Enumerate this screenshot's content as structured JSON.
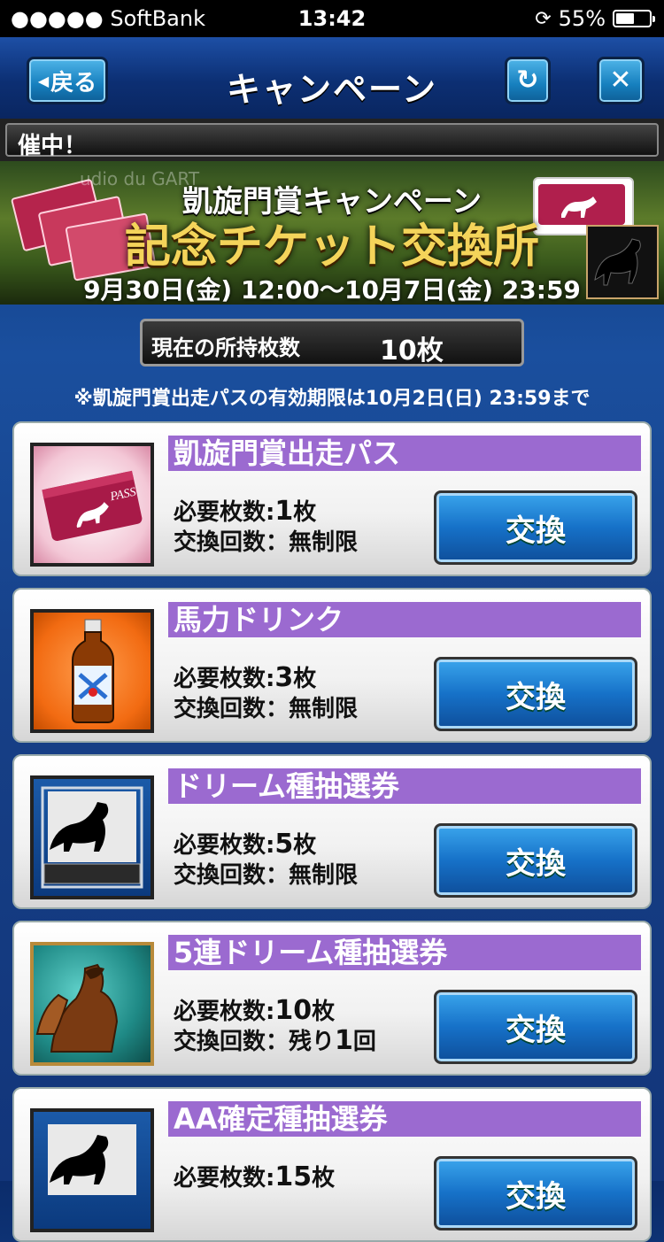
{
  "status_bar": {
    "carrier": "●●●●● SoftBank",
    "time": "13:42",
    "battery": "55%",
    "battery_level": 0.55
  },
  "header": {
    "title": "キャンペーン",
    "back_label": "戻る"
  },
  "ticker": {
    "text": "催中！"
  },
  "banner": {
    "bg_text": "udio du GART",
    "subtitle": "凱旋門賞キャンペーン",
    "title": "記念チケット交換所",
    "period": "9月30日(金) 12:00〜10月7日(金) 23:59"
  },
  "holdings": {
    "label": "現在の所持枚数",
    "value": "10枚"
  },
  "notice": "※凱旋門賞出走パスの有効期限は10月2日(日) 23:59まで",
  "items": [
    {
      "name": "凱旋門賞出走パス",
      "req_label": "必要枚数:",
      "req_num": "1",
      "req_unit": "枚",
      "count_label": "交換回数：",
      "count_value": "無制限",
      "count_suffix": "",
      "button": "交換",
      "thumb": "pass-ticket-icon"
    },
    {
      "name": "馬力ドリンク",
      "req_label": "必要枚数:",
      "req_num": "3",
      "req_unit": "枚",
      "count_label": "交換回数：",
      "count_value": "無制限",
      "count_suffix": "",
      "button": "交換",
      "thumb": "energy-drink-icon"
    },
    {
      "name": "ドリーム種抽選券",
      "req_label": "必要枚数:",
      "req_num": "5",
      "req_unit": "枚",
      "count_label": "交換回数：",
      "count_value": "無制限",
      "count_suffix": "",
      "button": "交換",
      "thumb": "dream-horse-icon"
    },
    {
      "name": "5連ドリーム種抽選券",
      "req_label": "必要枚数:",
      "req_num": "10",
      "req_unit": "枚",
      "count_label": "交換回数：残り",
      "count_value": "1",
      "count_suffix": "回",
      "button": "交換",
      "thumb": "horses-x5-icon"
    },
    {
      "name": "AA確定種抽選券",
      "req_label": "必要枚数:",
      "req_num": "15",
      "req_unit": "枚",
      "count_label": "",
      "count_value": "",
      "count_suffix": "",
      "button": "交換",
      "thumb": "aa-horse-icon"
    }
  ],
  "colors": {
    "name_bar": "#9b6ad0",
    "button_blue": "#1671c8",
    "background": "#163f86"
  }
}
